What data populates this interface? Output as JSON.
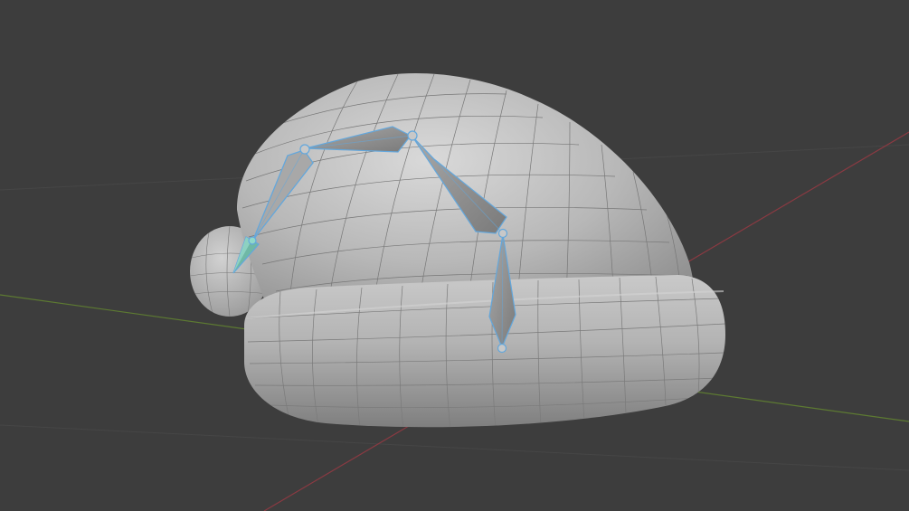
{
  "viewport": {
    "background": "#3d3d3d",
    "grid_axes": {
      "x_axis_color": "#8a3a42",
      "y_axis_color": "#5d7a32",
      "grid_line_color": "#474747"
    }
  },
  "scene": {
    "object": "santa-hat-mesh",
    "mesh": {
      "base_color": "#b4b4b4",
      "highlight_color": "#d6d6d6",
      "shadow_color": "#8c8c8c",
      "wire_color": "#707070"
    },
    "armature": {
      "bone_count": 5,
      "bone_fill": "#8e8e8e",
      "bone_fill_light": "#a9a9a9",
      "selection_outline": "#63a7dc",
      "active_tip_color": "#7fd4c8",
      "joint_color": "#c8c8c8"
    }
  }
}
